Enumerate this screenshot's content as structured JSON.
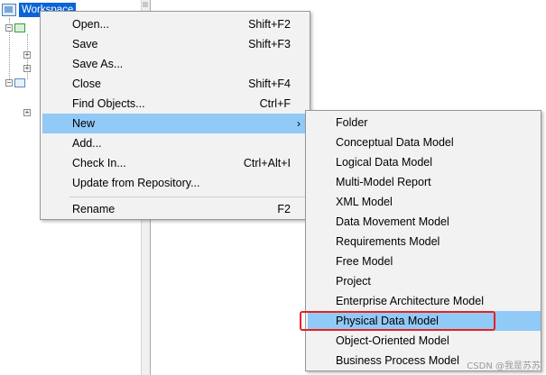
{
  "tree": {
    "root_label": "Workspace"
  },
  "context_menu": {
    "items": [
      {
        "label": "Open...",
        "shortcut": "Shift+F2"
      },
      {
        "label": "Save",
        "shortcut": "Shift+F3"
      },
      {
        "label": "Save As...",
        "shortcut": ""
      },
      {
        "label": "Close",
        "shortcut": "Shift+F4"
      },
      {
        "label": "Find Objects...",
        "shortcut": "Ctrl+F"
      },
      {
        "label": "New",
        "shortcut": "",
        "submenu_arrow": "›"
      },
      {
        "label": "Add...",
        "shortcut": ""
      },
      {
        "label": "Check In...",
        "shortcut": "Ctrl+Alt+I"
      },
      {
        "label": "Update from Repository...",
        "shortcut": ""
      },
      {
        "label": "Rename",
        "shortcut": "F2"
      }
    ],
    "highlighted": "New"
  },
  "new_submenu": {
    "items": [
      "Folder",
      "Conceptual Data Model",
      "Logical Data Model",
      "Multi-Model Report",
      "XML Model",
      "Data Movement Model",
      "Requirements Model",
      "Free Model",
      "Project",
      "Enterprise Architecture Model",
      "Physical Data Model",
      "Object-Oriented Model",
      "Business Process Model"
    ],
    "highlighted": "Physical Data Model",
    "annotation_color": "#e52222",
    "highlight_color": "#91c9f7"
  },
  "watermark": "CSDN @我是苏苏"
}
